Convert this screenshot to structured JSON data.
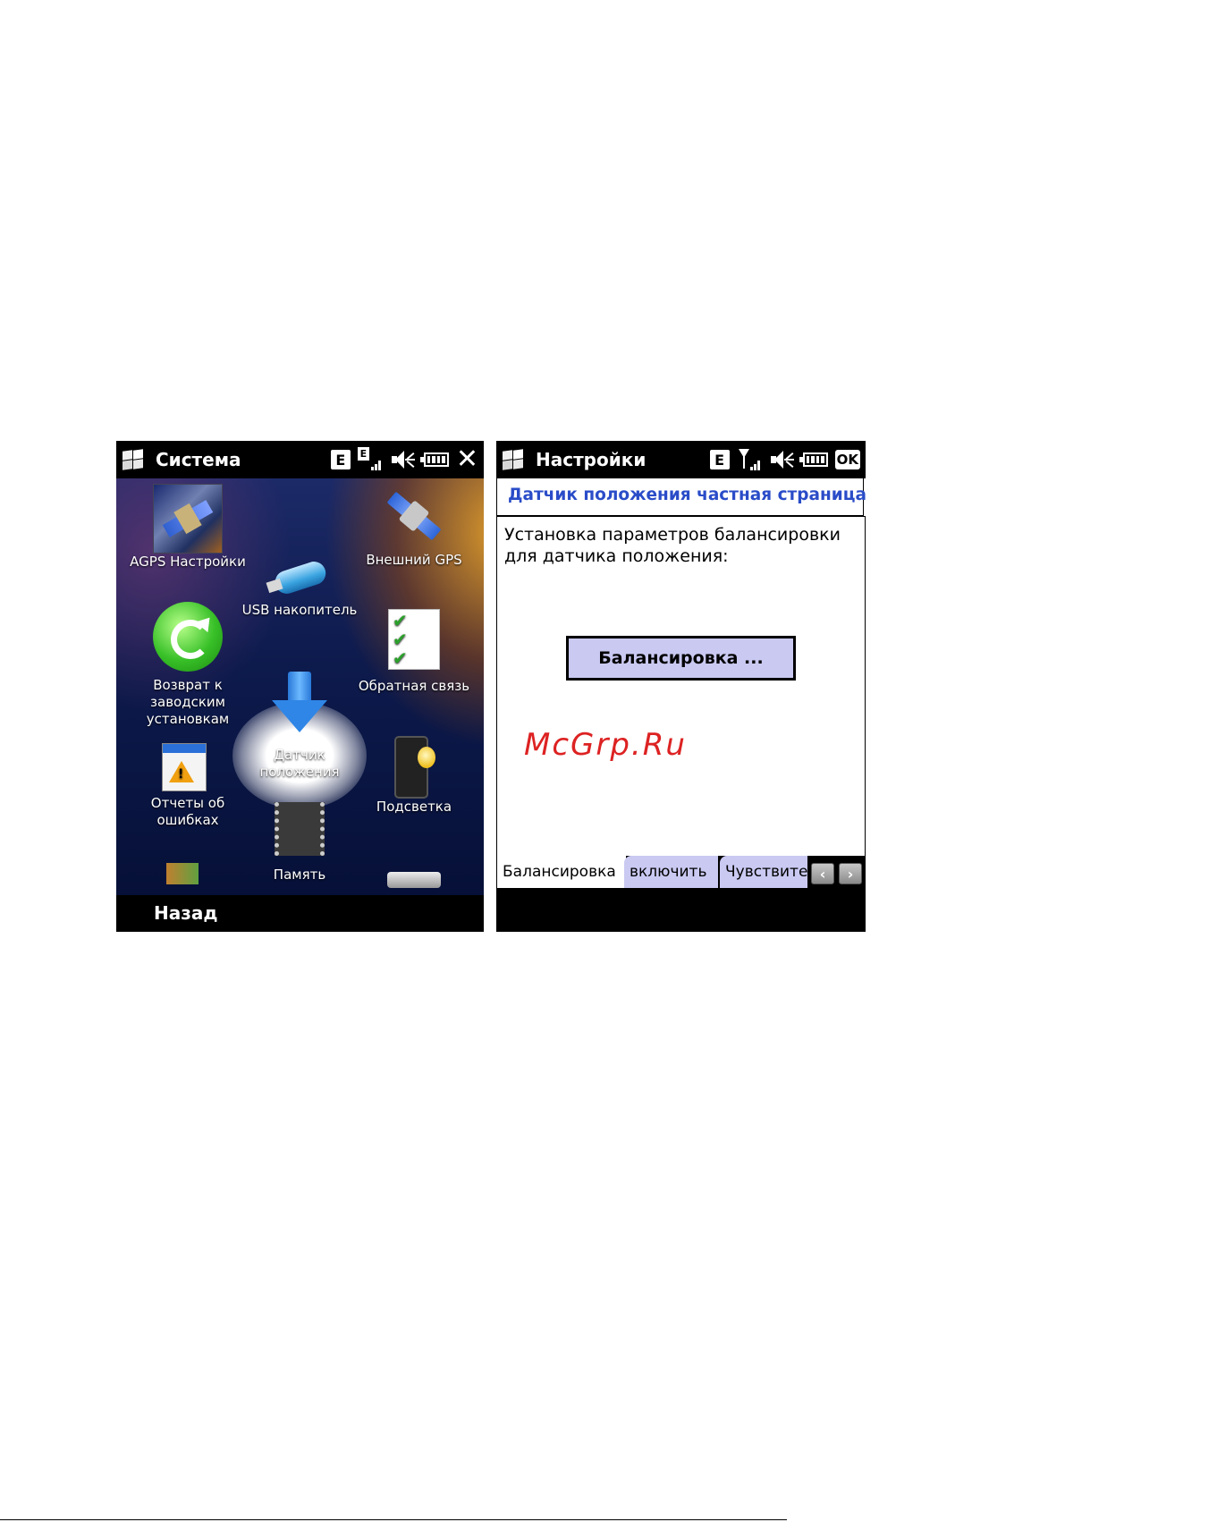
{
  "screen_left": {
    "title": "Система",
    "status": {
      "e_label": "E",
      "e_small": "E"
    },
    "apps": [
      {
        "id": "agps",
        "label": "AGPS Настройки"
      },
      {
        "id": "ext-gps",
        "label": "Внешний GPS"
      },
      {
        "id": "usb",
        "label": "USB накопитель"
      },
      {
        "id": "reset",
        "label": "Возврат к\nзаводским\nустановкам"
      },
      {
        "id": "feedback",
        "label": "Обратная связь"
      },
      {
        "id": "sensor",
        "label": "Датчик\nположения"
      },
      {
        "id": "reports",
        "label": "Отчеты об\nошибках"
      },
      {
        "id": "backlight",
        "label": "Подсветка"
      },
      {
        "id": "memory",
        "label": "Память"
      }
    ],
    "softkey_left": "Назад"
  },
  "screen_right": {
    "title": "Настройки",
    "status": {
      "e_label": "E",
      "ok_label": "OK"
    },
    "header": "Датчик положения частная страница",
    "description": "Установка параметров балансировки\nдля датчика положения:",
    "balance_button": "Балансировка ...",
    "watermark": "McGrp.Ru",
    "tabs": [
      "Балансировка",
      "включить",
      "Чувствите"
    ],
    "tab_prev": "‹",
    "tab_next": "›"
  }
}
